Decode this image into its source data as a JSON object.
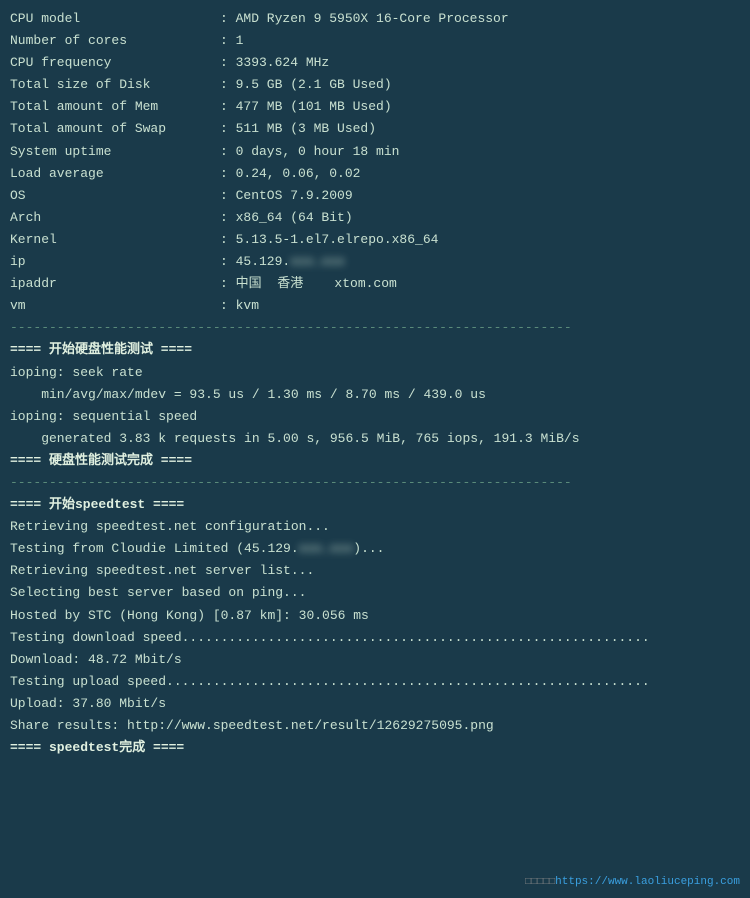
{
  "terminal": {
    "bg_color": "#1a3a4a",
    "lines": [
      {
        "type": "kv",
        "label": "CPU model",
        "value": ": AMD Ryzen 9 5950X 16-Core Processor"
      },
      {
        "type": "kv",
        "label": "Number of cores",
        "value": ": 1"
      },
      {
        "type": "kv",
        "label": "CPU frequency",
        "value": ": 3393.624 MHz"
      },
      {
        "type": "kv",
        "label": "Total size of Disk",
        "value": ": 9.5 GB (2.1 GB Used)"
      },
      {
        "type": "kv",
        "label": "Total amount of Mem",
        "value": ": 477 MB (101 MB Used)"
      },
      {
        "type": "kv",
        "label": "Total amount of Swap",
        "value": ": 511 MB (3 MB Used)"
      },
      {
        "type": "kv",
        "label": "System uptime",
        "value": ": 0 days, 0 hour 18 min"
      },
      {
        "type": "kv",
        "label": "Load average",
        "value": ": 0.24, 0.06, 0.02"
      },
      {
        "type": "kv",
        "label": "OS",
        "value": ": CentOS 7.9.2009"
      },
      {
        "type": "kv",
        "label": "Arch",
        "value": ": x86_64 (64 Bit)"
      },
      {
        "type": "kv",
        "label": "Kernel",
        "value": ": 5.13.5-1.el7.elrepo.x86_64"
      },
      {
        "type": "kv_blur",
        "label": "ip",
        "value": ": 45.129.",
        "blurred": "xxx.xxx"
      },
      {
        "type": "kv",
        "label": "ipaddr",
        "value": ": 中国  香港    xtom.com"
      },
      {
        "type": "kv",
        "label": "vm",
        "value": ": kvm"
      },
      {
        "type": "separator",
        "value": "------------------------------------------------------------------------"
      },
      {
        "type": "section",
        "value": "==== 开始硬盘性能测试 ===="
      },
      {
        "type": "normal",
        "value": "ioping: seek rate"
      },
      {
        "type": "indent",
        "value": "    min/avg/max/mdev = 93.5 us / 1.30 ms / 8.70 ms / 439.0 us"
      },
      {
        "type": "normal",
        "value": "ioping: sequential speed"
      },
      {
        "type": "indent",
        "value": "    generated 3.83 k requests in 5.00 s, 956.5 MiB, 765 iops, 191.3 MiB/s"
      },
      {
        "type": "section",
        "value": "==== 硬盘性能测试完成 ===="
      },
      {
        "type": "separator",
        "value": "------------------------------------------------------------------------"
      },
      {
        "type": "section",
        "value": "==== 开始speedtest ===="
      },
      {
        "type": "normal",
        "value": "Retrieving speedtest.net configuration..."
      },
      {
        "type": "normal_blur",
        "value": "Testing from Cloudie Limited (45.129.",
        "blurred": "xxx.xxx",
        "after": ")..."
      },
      {
        "type": "normal",
        "value": "Retrieving speedtest.net server list..."
      },
      {
        "type": "normal",
        "value": "Selecting best server based on ping..."
      },
      {
        "type": "normal",
        "value": "Hosted by STC (Hong Kong) [0.87 km]: 30.056 ms"
      },
      {
        "type": "normal",
        "value": "Testing download speed............................................................"
      },
      {
        "type": "normal",
        "value": "Download: 48.72 Mbit/s"
      },
      {
        "type": "normal",
        "value": "Testing upload speed.............................................................."
      },
      {
        "type": "normal",
        "value": "Upload: 37.80 Mbit/s"
      },
      {
        "type": "normal",
        "value": "Share results: http://www.speedtest.net/result/12629275095.png"
      },
      {
        "type": "section",
        "value": "==== speedtest完成 ===="
      }
    ]
  },
  "watermark": {
    "squares": "□□□□□",
    "url": "https://www.laoliuceping.com",
    "url_text": "https://www.laoliuceping.com"
  }
}
